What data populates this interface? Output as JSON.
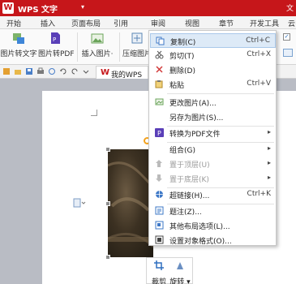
{
  "title_bar": {
    "app_title": "WPS 文字",
    "logo_text": "W",
    "dropdown": "▾"
  },
  "menu_tabs": [
    "开始",
    "插入",
    "页面布局",
    "引用",
    "审阅",
    "视图",
    "章节",
    "开发工具",
    "云"
  ],
  "ribbon": {
    "buttons": [
      "图片转文字",
      "图片转PDF",
      "插入图片·",
      "压缩图片"
    ]
  },
  "doc_tab": {
    "label": "我的WPS"
  },
  "context_menu": {
    "items": [
      {
        "label": "复制(C)",
        "shortcut": "Ctrl+C",
        "icon": "copy-icon",
        "hover": true
      },
      {
        "label": "剪切(T)",
        "shortcut": "Ctrl+X",
        "icon": "cut-icon"
      },
      {
        "label": "删除(D)",
        "shortcut": "",
        "icon": "delete-icon"
      },
      {
        "label": "粘贴",
        "shortcut": "Ctrl+V",
        "icon": "paste-icon"
      },
      {
        "label": "更改图片(A)...",
        "shortcut": "",
        "icon": "change-picture-icon"
      },
      {
        "label": "另存为图片(S)...",
        "shortcut": "",
        "icon": ""
      },
      {
        "label": "转换为PDF文件",
        "shortcut": "",
        "icon": "pdf-icon",
        "submenu": true
      },
      {
        "label": "组合(G)",
        "shortcut": "",
        "icon": "",
        "submenu": true
      },
      {
        "label": "置于顶层(U)",
        "shortcut": "",
        "icon": "bring-front-icon",
        "submenu": true,
        "disabled": true
      },
      {
        "label": "置于底层(K)",
        "shortcut": "",
        "icon": "send-back-icon",
        "submenu": true,
        "disabled": true
      },
      {
        "label": "超链接(H)...",
        "shortcut": "Ctrl+K",
        "icon": "hyperlink-icon"
      },
      {
        "label": "题注(Z)...",
        "shortcut": "",
        "icon": "caption-icon"
      },
      {
        "label": "其他布局选项(L)...",
        "shortcut": "",
        "icon": "layout-options-icon"
      },
      {
        "label": "设置对象格式(O)...",
        "shortcut": "",
        "icon": "format-object-icon"
      }
    ]
  },
  "float_toolbar": {
    "crop": "裁剪",
    "rotate": "旋转 ▾"
  },
  "ribbon_right": {
    "line1": "文",
    "check1": "✓"
  },
  "colors": {
    "brand": "#c6161a",
    "hover": "#ddeaf7",
    "pdf": "#5a3fb8"
  }
}
